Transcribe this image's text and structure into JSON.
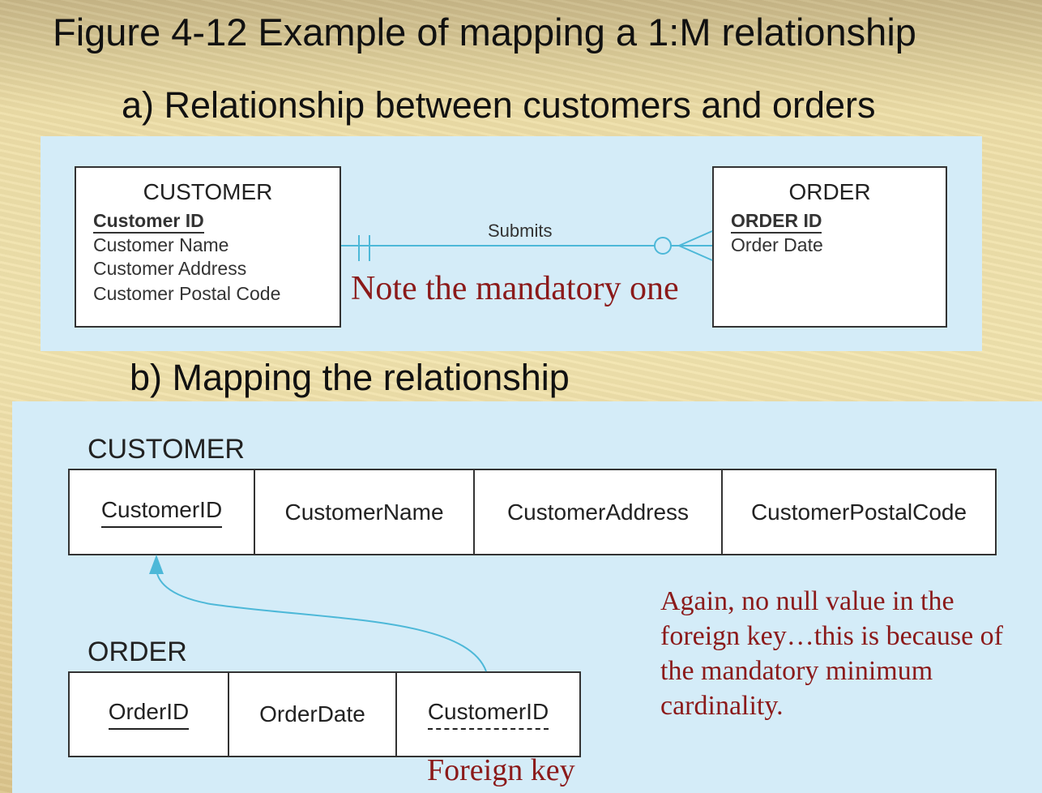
{
  "figure_title": "Figure 4-12 Example of mapping a 1:M relationship",
  "part_a_title": "a) Relationship between customers and orders",
  "part_b_title": "b) Mapping the relationship",
  "erd": {
    "customer": {
      "name": "CUSTOMER",
      "primary_key": "Customer ID",
      "attributes": [
        "Customer Name",
        "Customer Address",
        "Customer Postal Code"
      ]
    },
    "order": {
      "name": "ORDER",
      "primary_key": "ORDER ID",
      "attributes": [
        "Order Date"
      ]
    },
    "relationship": "Submits",
    "note": "Note the mandatory one"
  },
  "mapping": {
    "customer_relation": {
      "name": "CUSTOMER",
      "columns": [
        "CustomerID",
        "CustomerName",
        "CustomerAddress",
        "CustomerPostalCode"
      ]
    },
    "order_relation": {
      "name": "ORDER",
      "columns": [
        "OrderID",
        "OrderDate",
        "CustomerID"
      ]
    },
    "foreign_key_label": "Foreign key",
    "note": "Again, no null value in the foreign key…this is because of the mandatory minimum cardinality."
  },
  "colors": {
    "panel": "#d4ecf8",
    "connector": "#4db8d8",
    "note_text": "#8b1a1a"
  }
}
